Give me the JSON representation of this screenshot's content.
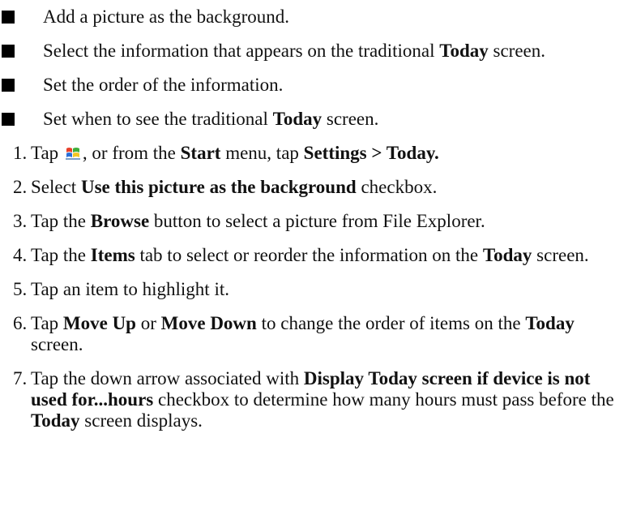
{
  "bullets": [
    {
      "segments": [
        {
          "t": "Add a picture as the background."
        }
      ]
    },
    {
      "segments": [
        {
          "t": "Select the information that appears on the traditional "
        },
        {
          "t": "Today",
          "b": true
        },
        {
          "t": " screen."
        }
      ]
    },
    {
      "segments": [
        {
          "t": "Set the order of the information."
        }
      ]
    },
    {
      "segments": [
        {
          "t": "Set when to see the traditional "
        },
        {
          "t": "Today",
          "b": true
        },
        {
          "t": " screen."
        }
      ]
    }
  ],
  "steps": [
    {
      "num": "1.",
      "segments": [
        {
          "t": "Tap "
        },
        {
          "icon": "windows-start-icon"
        },
        {
          "t": ", or from the "
        },
        {
          "t": "Start",
          "b": true
        },
        {
          "t": " menu, tap "
        },
        {
          "t": "Settings > Today.",
          "b": true
        }
      ]
    },
    {
      "num": "2.",
      "segments": [
        {
          "t": "Select "
        },
        {
          "t": "Use this picture as the background",
          "b": true
        },
        {
          "t": " checkbox."
        }
      ]
    },
    {
      "num": "3.",
      "segments": [
        {
          "t": "Tap the "
        },
        {
          "t": "Browse",
          "b": true
        },
        {
          "t": " button to select a picture from File Explorer."
        }
      ]
    },
    {
      "num": "4.",
      "segments": [
        {
          "t": "Tap the "
        },
        {
          "t": "Items",
          "b": true
        },
        {
          "t": " tab to select or reorder the information on the "
        },
        {
          "t": "Today",
          "b": true
        },
        {
          "t": " screen."
        }
      ]
    },
    {
      "num": "5.",
      "segments": [
        {
          "t": "Tap an item to highlight it."
        }
      ]
    },
    {
      "num": "6.",
      "segments": [
        {
          "t": "Tap "
        },
        {
          "t": "Move Up",
          "b": true
        },
        {
          "t": " or "
        },
        {
          "t": "Move Down",
          "b": true
        },
        {
          "t": " to change the order of items on the "
        },
        {
          "t": "Today",
          "b": true
        },
        {
          "t": " screen."
        }
      ]
    },
    {
      "num": "7.",
      "segments": [
        {
          "t": "Tap the down arrow associated with "
        },
        {
          "t": "Display Today screen if device is not used for...hours",
          "b": true
        },
        {
          "t": " checkbox to determine how many hours must pass before the "
        },
        {
          "t": "Today",
          "b": true
        },
        {
          "t": " screen displays."
        }
      ]
    }
  ]
}
